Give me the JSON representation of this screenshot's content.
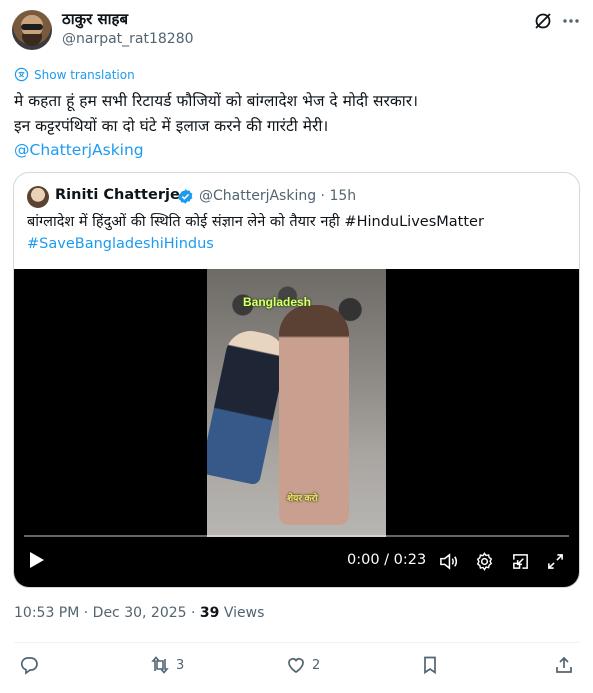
{
  "author": {
    "display_name": "ठाकुर साहब",
    "handle": "@narpat_rat18280"
  },
  "show_translation": "Show translation",
  "tweet": {
    "lines": [
      "मे कहता हूं हम सभी रिटायर्ड फौजियों को बांग्लादेश भेज दे मोदी सरकार।",
      "इन कट्टरपंथियों का दो घंटे में इलाज करने की गारंटी मेरी।"
    ],
    "mention": "@ChatterjAsking"
  },
  "quote": {
    "display_name": "Riniti Chatterjee",
    "handle_time": "@ChatterjAsking · 15h",
    "lines": [
      "बांग्लादेश में हिंदुओं की स्थिति कोई संज्ञान लेने को तैयार नही #HinduLivesMatter",
      "#SaveBangladeshiHindus"
    ],
    "video": {
      "overlay_top": "Bangladesh",
      "overlay_bottom": "शेयर करो",
      "time": "0:00 / 0:23",
      "progress": 0
    }
  },
  "meta": {
    "timestamp": "10:53 PM · Dec 30, 2025 · ",
    "views_count": "39",
    "views_label": " Views"
  },
  "actions": {
    "reply_count": "",
    "retweet_count": "3",
    "like_count": "2"
  },
  "colors": {
    "accent": "#1d9bf0",
    "text": "#0f1419",
    "secondary": "#536471",
    "border": "#cfd9de"
  },
  "icons": [
    "grok-icon",
    "more-icon",
    "translate-icon",
    "verified-icon",
    "play-icon",
    "volume-icon",
    "settings-icon",
    "pip-icon",
    "fullscreen-icon",
    "reply-icon",
    "retweet-icon",
    "like-icon",
    "bookmark-icon",
    "share-icon"
  ]
}
